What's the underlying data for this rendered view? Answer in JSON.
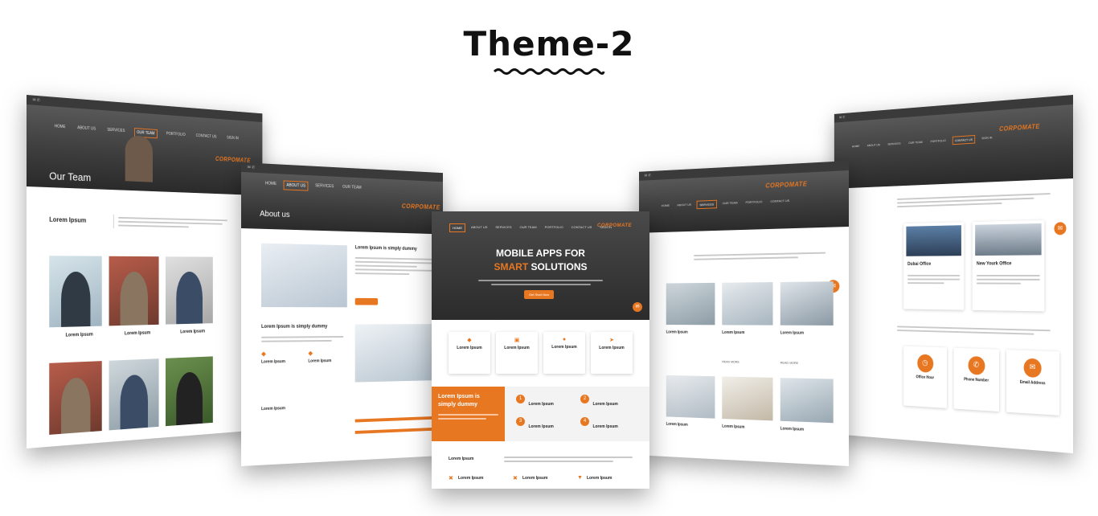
{
  "heading": "Theme-2",
  "brand": "CORPOMATE",
  "nav": {
    "home": "HOME",
    "about": "ABOUT US",
    "services": "SERVICES",
    "our_team": "OUR TEAM",
    "portfolio": "PORTFOLIO",
    "contact": "CONTACT US",
    "sign_in": "SIGN IN"
  },
  "team_page": {
    "banner_title": "Our Team",
    "section_title": "Lorem Ipsum",
    "members": [
      {
        "name": "Lorem Ipsum"
      },
      {
        "name": "Lorem Ipsum"
      },
      {
        "name": "Lorem Ipsum"
      }
    ]
  },
  "about_page": {
    "banner_title": "About us",
    "feature_title": "Lorem Ipsum is simply dummy",
    "sub_title": "Lorem Ipsum is simply dummy",
    "col1": "Lorem Ipsum",
    "col2": "Lorem Ipsum",
    "footer_label": "Lorem Ipsum"
  },
  "home_page": {
    "hero_line1": "MOBILE APPS FOR",
    "hero_line2_accent": "SMART",
    "hero_line2_rest": " SOLUTIONS",
    "hero_button": "Get Start Now",
    "features": [
      {
        "title": "Lorem Ipsum",
        "icon": "diamond-icon"
      },
      {
        "title": "Lorem Ipsum",
        "icon": "lock-icon"
      },
      {
        "title": "Lorem Ipsum",
        "icon": "globe-icon"
      },
      {
        "title": "Lorem Ipsum",
        "icon": "rocket-icon"
      }
    ],
    "promo": "Lorem Ipsum is simply dummy",
    "steps": [
      {
        "num": "1",
        "title": "Lorem Ipsum"
      },
      {
        "num": "2",
        "title": "Lorem Ipsum"
      },
      {
        "num": "3",
        "title": "Lorem Ipsum"
      },
      {
        "num": "4",
        "title": "Lorem Ipsum"
      }
    ],
    "bottom_title": "Lorem Ipsum",
    "bottom_items": [
      "Lorem Ipsum",
      "Lorem Ipsum",
      "Lorem Ipsum"
    ]
  },
  "services_page": {
    "items": [
      "Lorem Ipsum",
      "Lorem Ipsum",
      "Lorem Ipsum",
      "Lorem Ipsum",
      "Lorem Ipsum",
      "Lorem Ipsum"
    ],
    "read_more": "READ MORE"
  },
  "contact_page": {
    "offices": [
      {
        "title": "Dubai Office"
      },
      {
        "title": "New Yourk Office"
      }
    ],
    "info": [
      {
        "title": "Office Hour",
        "icon": "clock-icon"
      },
      {
        "title": "Phone Number",
        "icon": "phone-icon"
      },
      {
        "title": "Email Address",
        "icon": "mail-icon"
      }
    ]
  },
  "colors": {
    "accent": "#e87722",
    "dark": "#3a3a3a"
  }
}
